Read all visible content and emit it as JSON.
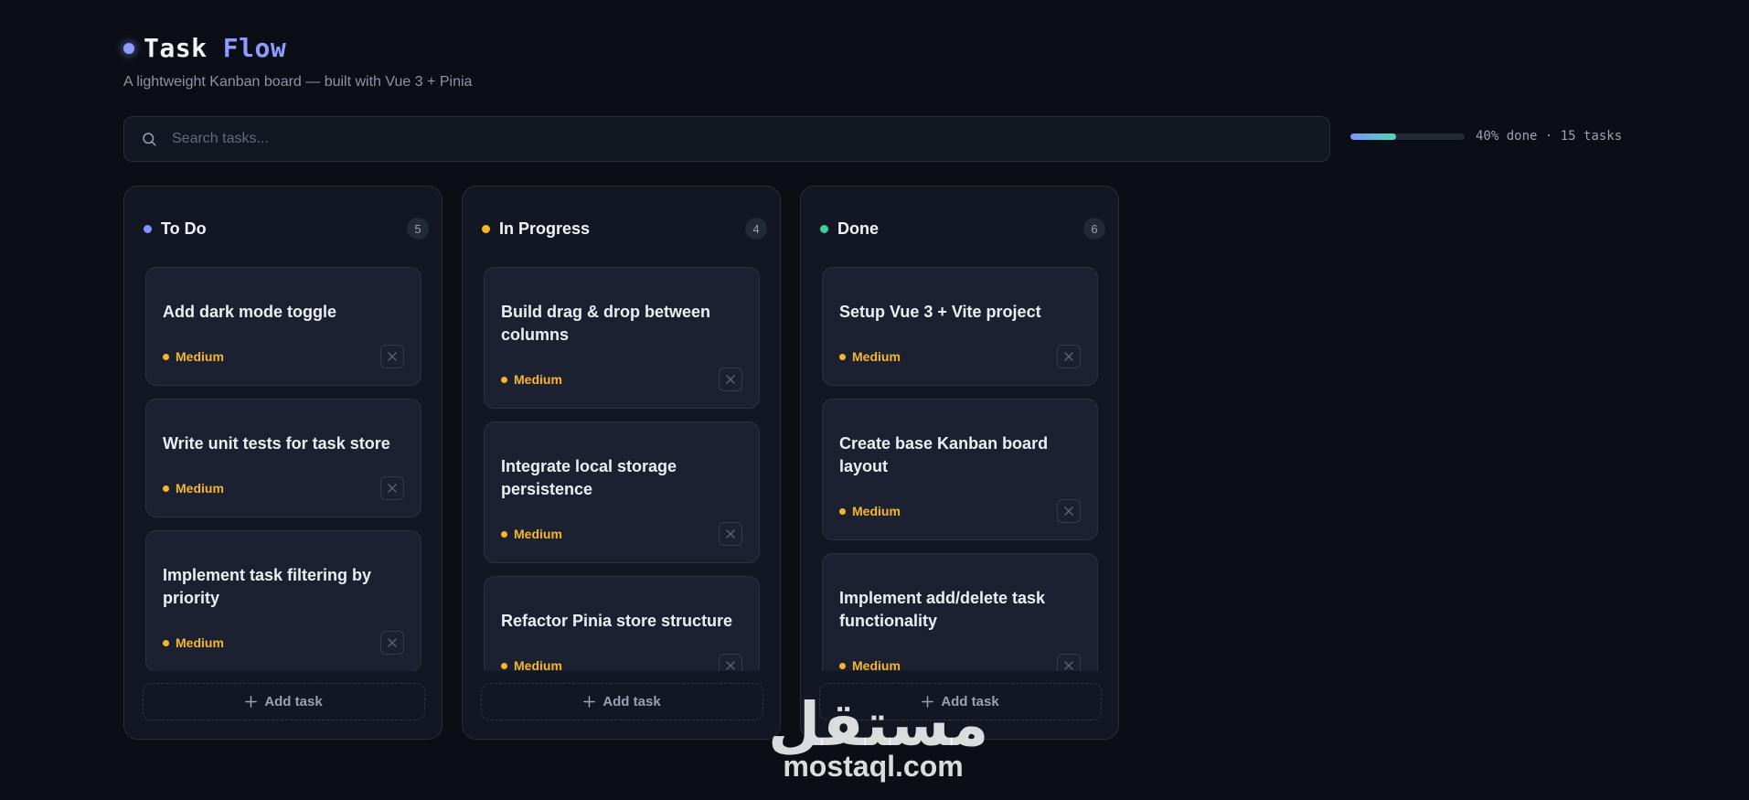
{
  "header": {
    "title_word1": "Task",
    "title_word2": "Flow",
    "subtitle": "A lightweight Kanban board — built with Vue 3 + Pinia"
  },
  "search": {
    "placeholder": "Search tasks...",
    "value": ""
  },
  "progress": {
    "percent": 40,
    "text": "40% done · 15 tasks"
  },
  "columns": [
    {
      "title": "To Do",
      "count": "5",
      "dot_color": "#7d93ff",
      "cards": [
        {
          "title": "Add dark mode toggle",
          "priority": "Medium"
        },
        {
          "title": "Write unit tests for task store",
          "priority": "Medium"
        },
        {
          "title": "Implement task filtering by priority",
          "priority": "Medium"
        }
      ],
      "add_label": "Add task"
    },
    {
      "title": "In Progress",
      "count": "4",
      "dot_color": "#f7b62a",
      "cards": [
        {
          "title": "Build drag & drop between columns",
          "priority": "Medium"
        },
        {
          "title": "Integrate local storage persistence",
          "priority": "Medium"
        },
        {
          "title": "Refactor Pinia store structure",
          "priority": "Medium"
        }
      ],
      "add_label": "Add task"
    },
    {
      "title": "Done",
      "count": "6",
      "dot_color": "#3ccf9e",
      "cards": [
        {
          "title": "Setup Vue 3 + Vite project",
          "priority": "Medium"
        },
        {
          "title": "Create base Kanban board layout",
          "priority": "Medium"
        },
        {
          "title": "Implement add/delete task functionality",
          "priority": "Medium"
        }
      ],
      "add_label": "Add task"
    }
  ],
  "watermark": {
    "arabic": "مستقل",
    "latin": "mostaql.com"
  },
  "colors": {
    "accent": "#8c9cff",
    "priority_medium": "#f7b62a",
    "done": "#3ccf9e"
  }
}
